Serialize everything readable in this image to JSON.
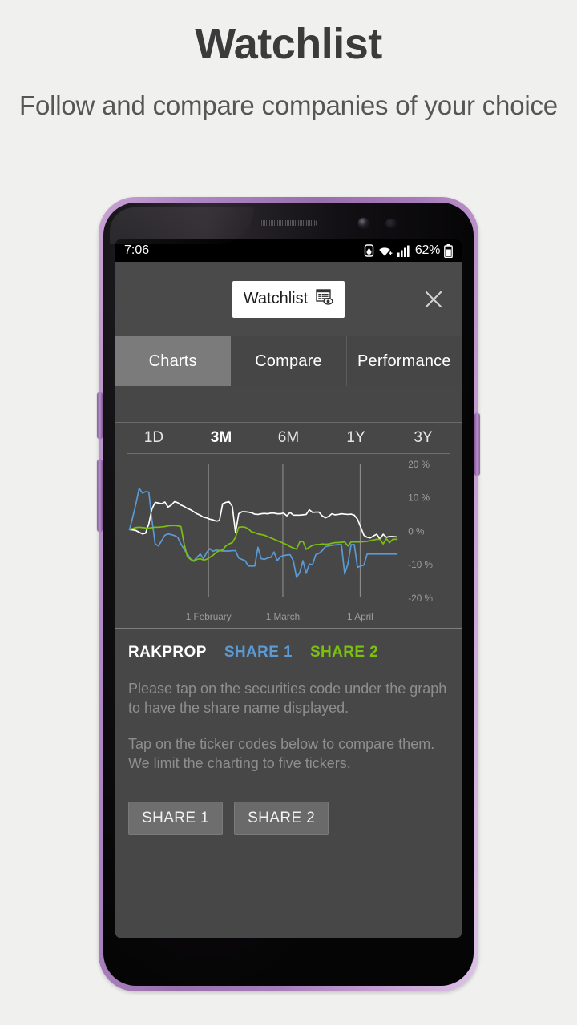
{
  "promo": {
    "title": "Watchlist",
    "subtitle": "Follow and compare companies of your choice"
  },
  "status_bar": {
    "time": "7:06",
    "battery_percent": "62%",
    "icons": [
      "water-drop-icon",
      "wifi-icon",
      "cellular-signal-icon",
      "battery-icon"
    ]
  },
  "app_bar": {
    "title": "Watchlist",
    "title_icon": "watchlist-document-eye-icon",
    "close_icon": "close-icon"
  },
  "tabs": [
    {
      "label": "Charts",
      "active": true
    },
    {
      "label": "Compare",
      "active": false
    },
    {
      "label": "Performance",
      "active": false
    }
  ],
  "ranges": [
    {
      "label": "1D",
      "active": false
    },
    {
      "label": "3M",
      "active": true
    },
    {
      "label": "6M",
      "active": false
    },
    {
      "label": "1Y",
      "active": false
    },
    {
      "label": "3Y",
      "active": false
    }
  ],
  "legend": [
    {
      "label": "RAKPROP",
      "color": "#ffffff"
    },
    {
      "label": "SHARE 1",
      "color": "#5b9bd5"
    },
    {
      "label": "SHARE 2",
      "color": "#7cc00f"
    }
  ],
  "help_text": {
    "line1": "Please tap on the securities code under the graph to have the share name displayed.",
    "line2": "Tap on the ticker codes below to compare them. We limit the charting to five tickers."
  },
  "ticker_buttons": [
    {
      "label": "SHARE 1"
    },
    {
      "label": "SHARE 2"
    }
  ],
  "colors": {
    "screen_bg": "#474747",
    "tab_active_bg": "#7b7b7b",
    "series_rakprop": "#ffffff",
    "series_share1": "#5b9bd5",
    "series_share2": "#7cc00f",
    "frame_purple": "#b188c4"
  },
  "chart_data": {
    "type": "line",
    "title": "",
    "xlabel": "",
    "ylabel": "%",
    "grid": true,
    "legend_position": "below",
    "ylim": [
      -20,
      20
    ],
    "yticks": [
      20,
      10,
      0,
      -10,
      -20
    ],
    "ytick_labels": [
      "20 %",
      "10 %",
      "0 %",
      "-10 %",
      "-20 %"
    ],
    "xticks": [
      0.295,
      0.573,
      0.862
    ],
    "xtick_labels": [
      "1 February",
      "1 March",
      "1 April"
    ],
    "x": [
      0.0,
      0.012,
      0.024,
      0.036,
      0.048,
      0.06,
      0.072,
      0.084,
      0.096,
      0.108,
      0.12,
      0.132,
      0.144,
      0.156,
      0.168,
      0.18,
      0.192,
      0.204,
      0.216,
      0.228,
      0.24,
      0.252,
      0.264,
      0.276,
      0.288,
      0.3,
      0.312,
      0.324,
      0.336,
      0.348,
      0.36,
      0.372,
      0.384,
      0.396,
      0.408,
      0.42,
      0.432,
      0.444,
      0.456,
      0.468,
      0.48,
      0.492,
      0.504,
      0.516,
      0.528,
      0.54,
      0.552,
      0.564,
      0.576,
      0.588,
      0.6,
      0.612,
      0.624,
      0.636,
      0.648,
      0.66,
      0.672,
      0.684,
      0.696,
      0.708,
      0.72,
      0.732,
      0.744,
      0.756,
      0.768,
      0.78,
      0.792,
      0.804,
      0.816,
      0.828,
      0.84,
      0.852,
      0.864,
      0.876,
      0.888,
      0.9,
      0.912,
      0.924,
      0.936,
      0.948,
      0.96,
      0.972,
      0.984,
      1.0
    ],
    "series": [
      {
        "name": "RAKPROP",
        "color": "#ffffff",
        "values": [
          0.3,
          0.2,
          0.0,
          -0.5,
          -1.0,
          -0.8,
          2.0,
          6.5,
          8.4,
          8.2,
          8.0,
          8.5,
          7.0,
          7.6,
          8.6,
          8.3,
          7.6,
          7.2,
          6.6,
          6.2,
          5.6,
          5.0,
          4.6,
          4.0,
          3.8,
          3.4,
          3.2,
          2.8,
          3.0,
          8.0,
          8.4,
          8.6,
          7.2,
          -0.6,
          5.0,
          5.6,
          5.6,
          5.5,
          5.3,
          4.9,
          4.8,
          5.0,
          5.1,
          5.0,
          5.2,
          5.2,
          5.0,
          5.0,
          5.2,
          4.4,
          5.4,
          4.6,
          4.6,
          4.6,
          4.7,
          4.8,
          6.2,
          5.4,
          5.5,
          5.5,
          4.4,
          3.8,
          4.2,
          5.0,
          4.7,
          4.8,
          5.0,
          4.9,
          4.8,
          4.9,
          4.6,
          3.4,
          1.0,
          -1.4,
          -2.0,
          -2.2,
          -1.6,
          -1.1,
          -2.6,
          -1.1,
          -2.0,
          -1.8,
          -1.8,
          -1.9
        ]
      },
      {
        "name": "SHARE 1",
        "color": "#5b9bd5",
        "values": [
          0.3,
          4.0,
          8.0,
          12.6,
          11.2,
          11.6,
          11.5,
          3.0,
          -4.0,
          -4.6,
          -3.0,
          -1.4,
          -1.0,
          -1.2,
          -1.5,
          -2.0,
          -4.0,
          -5.6,
          -7.0,
          -8.5,
          -9.0,
          -8.0,
          -7.0,
          -8.4,
          -6.6,
          -5.4,
          -6.2,
          -5.8,
          -6.0,
          -6.1,
          -6.1,
          -6.1,
          -6.0,
          -6.0,
          -8.2,
          -8.6,
          -9.0,
          -10.6,
          -10.6,
          -10.6,
          -5.0,
          -8.4,
          -8.6,
          -8.2,
          -8.0,
          -6.4,
          -9.0,
          -7.8,
          -7.5,
          -7.3,
          -7.2,
          -9.0,
          -14.0,
          -12.6,
          -9.0,
          -12.8,
          -10.0,
          -10.2,
          -7.2,
          -6.8,
          -6.0,
          -4.8,
          -4.6,
          -4.4,
          -4.3,
          -4.2,
          -4.2,
          -13.0,
          -10.0,
          -4.2,
          -4.2,
          -11.0,
          -10.6,
          -10.3,
          -7.0,
          -7.0,
          -7.0,
          -7.0,
          -7.0,
          -7.0,
          -7.0,
          -7.0,
          -7.0,
          -7.0
        ]
      },
      {
        "name": "SHARE 2",
        "color": "#7cc00f",
        "values": [
          0.3,
          0.6,
          0.9,
          1.0,
          0.9,
          0.8,
          0.7,
          0.9,
          1.0,
          1.0,
          1.1,
          1.2,
          1.4,
          1.5,
          1.5,
          1.4,
          1.2,
          -4.0,
          -7.8,
          -8.6,
          -9.2,
          -8.6,
          -8.4,
          -8.8,
          -8.6,
          -8.0,
          -7.4,
          -6.5,
          -6.0,
          -5.8,
          -4.6,
          -4.0,
          -3.6,
          -2.0,
          1.0,
          1.1,
          1.0,
          0.5,
          -0.4,
          -0.6,
          -1.0,
          -1.2,
          -1.4,
          -1.8,
          -2.2,
          -2.6,
          -3.0,
          -3.4,
          -3.8,
          -4.2,
          -4.8,
          -5.2,
          -5.6,
          -3.4,
          -3.2,
          -5.6,
          -5.0,
          -4.4,
          -4.2,
          -4.2,
          -4.0,
          -4.1,
          -4.0,
          -3.8,
          -3.6,
          -3.6,
          -3.5,
          -3.4,
          -4.6,
          -3.4,
          -3.4,
          -3.4,
          -3.4,
          -3.3,
          -3.2,
          -3.0,
          -2.8,
          -2.6,
          -2.6,
          -4.0,
          -2.4,
          -3.6,
          -2.6,
          -2.6
        ]
      }
    ]
  }
}
